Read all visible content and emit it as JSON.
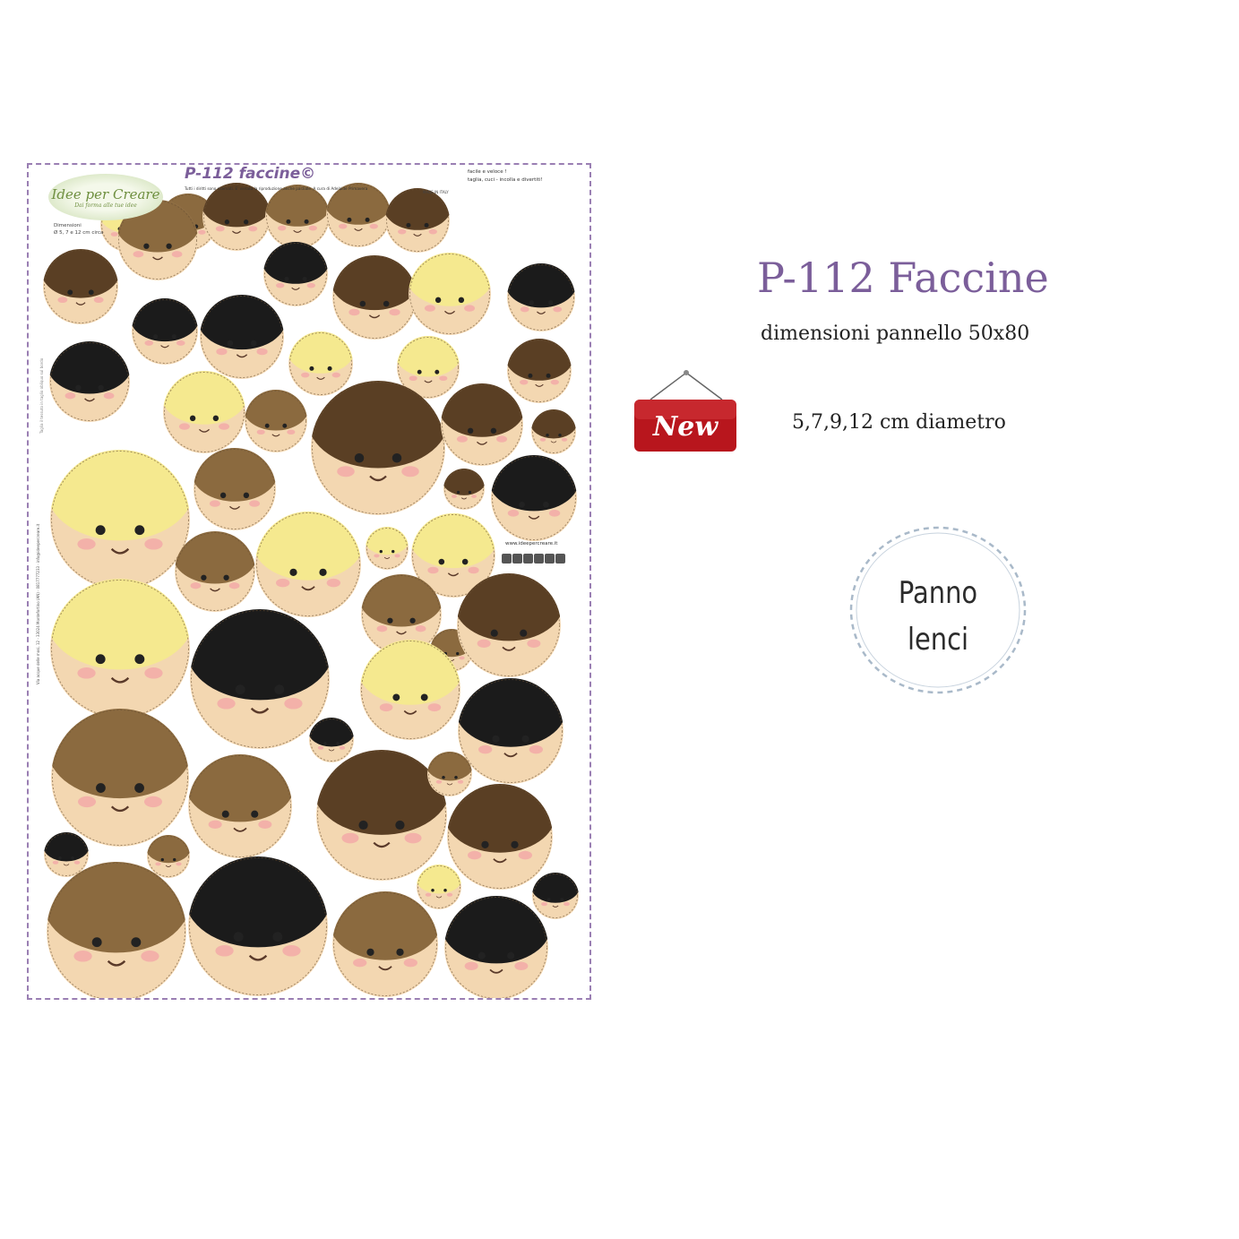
{
  "panel": {
    "logo_line1": "Idee per Creare",
    "logo_line2": "Dai forma alle tue idee",
    "title": "P-112 faccine©",
    "notice": "Tutti i diritti sono riservati. E' vietata la riproduzione anche parziale. A cura di Adelaide Primavera",
    "features": [
      "facile e veloce !",
      "taglia, cuci - incolla e divertiti!"
    ],
    "made_in": "MADE IN ITALY",
    "dimensions_label": "Dimensioni",
    "dimensions_value": "Ø 5, 7 e 12 cm circa",
    "website": "www.ideepercreare.it",
    "address": "Via acque delle mosi, 12 - 33024 Montefortino (AN) · 0817777233 · info@ideepercreare.it",
    "side_text": "Taglia il tessuto in taglio obliquo sul bordo"
  },
  "new_tag": "New",
  "heading": {
    "title": "P-112 Faccine",
    "subtitle": "dimensioni pannello 50x80",
    "diameter": "5,7,9,12 cm diametro"
  },
  "badge": {
    "line1": "Panno",
    "line2": "lenci"
  },
  "colors": {
    "title_purple": "#7b5e9a",
    "skin": "#f3d7b1",
    "hair_brown": "#8b6a3f",
    "hair_dark_brown": "#5a3f24",
    "hair_black": "#1b1b1b",
    "hair_blond": "#f5e98f",
    "new_red": "#b8161d"
  }
}
